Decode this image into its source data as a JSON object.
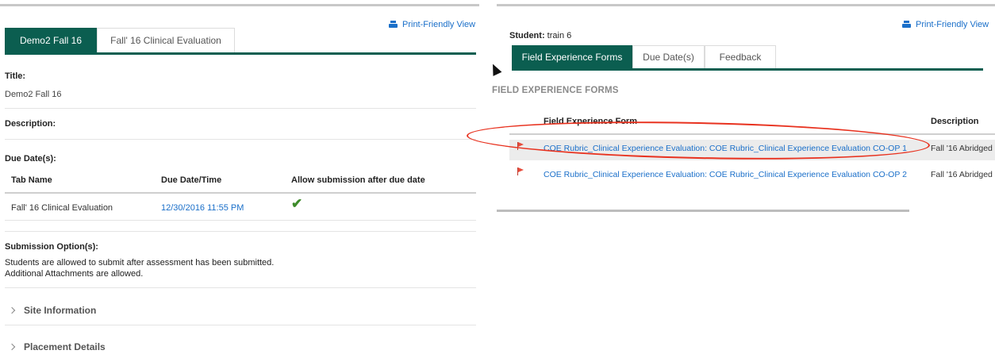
{
  "left": {
    "print_label": "Print-Friendly View",
    "tabs": [
      {
        "label": "Demo2 Fall 16"
      },
      {
        "label": "Fall' 16 Clinical Evaluation"
      }
    ],
    "title_label": "Title:",
    "title_value": "Demo2 Fall 16",
    "description_label": "Description:",
    "due_dates_label": "Due Date(s):",
    "table": {
      "headers": [
        "Tab Name",
        "Due Date/Time",
        "Allow submission after due date"
      ],
      "rows": [
        {
          "tab_name": "Fall' 16 Clinical Evaluation",
          "due": "12/30/2016 11:55 PM",
          "allow": "✔"
        }
      ]
    },
    "submission_label": "Submission Option(s):",
    "submission_lines": [
      "Students are allowed to submit after assessment has been submitted.",
      "Additional Attachments are allowed."
    ],
    "sections": [
      {
        "label": "Site Information"
      },
      {
        "label": "Placement Details"
      }
    ]
  },
  "right": {
    "print_label": "Print-Friendly View",
    "student_label": "Student:",
    "student_value": "train 6",
    "tabs": [
      {
        "label": "Field Experience Forms"
      },
      {
        "label": "Due Date(s)"
      },
      {
        "label": "Feedback"
      }
    ],
    "section_heading": "FIELD EXPERIENCE FORMS",
    "table": {
      "headers": [
        "Field Experience Form",
        "Description"
      ],
      "rows": [
        {
          "form": "COE Rubric_Clinical Experience Evaluation: COE Rubric_Clinical Experience Evaluation CO-OP 1",
          "description": "Fall '16 Abridged"
        },
        {
          "form": "COE Rubric_Clinical Experience Evaluation: COE Rubric_Clinical Experience Evaluation CO-OP 2",
          "description": "Fall '16 Abridged"
        }
      ]
    }
  },
  "colors": {
    "accent": "#0b5e50",
    "link": "#1a6fc9",
    "annotation": "#e8321f",
    "check": "#3d8b2a"
  }
}
